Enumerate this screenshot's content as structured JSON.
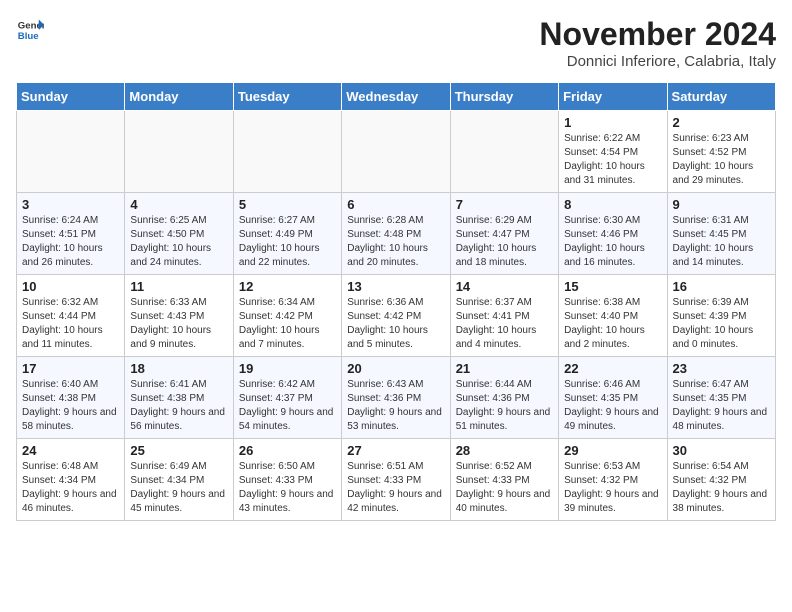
{
  "logo": {
    "line1": "General",
    "line2": "Blue"
  },
  "title": "November 2024",
  "subtitle": "Donnici Inferiore, Calabria, Italy",
  "days_header": [
    "Sunday",
    "Monday",
    "Tuesday",
    "Wednesday",
    "Thursday",
    "Friday",
    "Saturday"
  ],
  "weeks": [
    [
      {
        "day": "",
        "info": ""
      },
      {
        "day": "",
        "info": ""
      },
      {
        "day": "",
        "info": ""
      },
      {
        "day": "",
        "info": ""
      },
      {
        "day": "",
        "info": ""
      },
      {
        "day": "1",
        "info": "Sunrise: 6:22 AM\nSunset: 4:54 PM\nDaylight: 10 hours and 31 minutes."
      },
      {
        "day": "2",
        "info": "Sunrise: 6:23 AM\nSunset: 4:52 PM\nDaylight: 10 hours and 29 minutes."
      }
    ],
    [
      {
        "day": "3",
        "info": "Sunrise: 6:24 AM\nSunset: 4:51 PM\nDaylight: 10 hours and 26 minutes."
      },
      {
        "day": "4",
        "info": "Sunrise: 6:25 AM\nSunset: 4:50 PM\nDaylight: 10 hours and 24 minutes."
      },
      {
        "day": "5",
        "info": "Sunrise: 6:27 AM\nSunset: 4:49 PM\nDaylight: 10 hours and 22 minutes."
      },
      {
        "day": "6",
        "info": "Sunrise: 6:28 AM\nSunset: 4:48 PM\nDaylight: 10 hours and 20 minutes."
      },
      {
        "day": "7",
        "info": "Sunrise: 6:29 AM\nSunset: 4:47 PM\nDaylight: 10 hours and 18 minutes."
      },
      {
        "day": "8",
        "info": "Sunrise: 6:30 AM\nSunset: 4:46 PM\nDaylight: 10 hours and 16 minutes."
      },
      {
        "day": "9",
        "info": "Sunrise: 6:31 AM\nSunset: 4:45 PM\nDaylight: 10 hours and 14 minutes."
      }
    ],
    [
      {
        "day": "10",
        "info": "Sunrise: 6:32 AM\nSunset: 4:44 PM\nDaylight: 10 hours and 11 minutes."
      },
      {
        "day": "11",
        "info": "Sunrise: 6:33 AM\nSunset: 4:43 PM\nDaylight: 10 hours and 9 minutes."
      },
      {
        "day": "12",
        "info": "Sunrise: 6:34 AM\nSunset: 4:42 PM\nDaylight: 10 hours and 7 minutes."
      },
      {
        "day": "13",
        "info": "Sunrise: 6:36 AM\nSunset: 4:42 PM\nDaylight: 10 hours and 5 minutes."
      },
      {
        "day": "14",
        "info": "Sunrise: 6:37 AM\nSunset: 4:41 PM\nDaylight: 10 hours and 4 minutes."
      },
      {
        "day": "15",
        "info": "Sunrise: 6:38 AM\nSunset: 4:40 PM\nDaylight: 10 hours and 2 minutes."
      },
      {
        "day": "16",
        "info": "Sunrise: 6:39 AM\nSunset: 4:39 PM\nDaylight: 10 hours and 0 minutes."
      }
    ],
    [
      {
        "day": "17",
        "info": "Sunrise: 6:40 AM\nSunset: 4:38 PM\nDaylight: 9 hours and 58 minutes."
      },
      {
        "day": "18",
        "info": "Sunrise: 6:41 AM\nSunset: 4:38 PM\nDaylight: 9 hours and 56 minutes."
      },
      {
        "day": "19",
        "info": "Sunrise: 6:42 AM\nSunset: 4:37 PM\nDaylight: 9 hours and 54 minutes."
      },
      {
        "day": "20",
        "info": "Sunrise: 6:43 AM\nSunset: 4:36 PM\nDaylight: 9 hours and 53 minutes."
      },
      {
        "day": "21",
        "info": "Sunrise: 6:44 AM\nSunset: 4:36 PM\nDaylight: 9 hours and 51 minutes."
      },
      {
        "day": "22",
        "info": "Sunrise: 6:46 AM\nSunset: 4:35 PM\nDaylight: 9 hours and 49 minutes."
      },
      {
        "day": "23",
        "info": "Sunrise: 6:47 AM\nSunset: 4:35 PM\nDaylight: 9 hours and 48 minutes."
      }
    ],
    [
      {
        "day": "24",
        "info": "Sunrise: 6:48 AM\nSunset: 4:34 PM\nDaylight: 9 hours and 46 minutes."
      },
      {
        "day": "25",
        "info": "Sunrise: 6:49 AM\nSunset: 4:34 PM\nDaylight: 9 hours and 45 minutes."
      },
      {
        "day": "26",
        "info": "Sunrise: 6:50 AM\nSunset: 4:33 PM\nDaylight: 9 hours and 43 minutes."
      },
      {
        "day": "27",
        "info": "Sunrise: 6:51 AM\nSunset: 4:33 PM\nDaylight: 9 hours and 42 minutes."
      },
      {
        "day": "28",
        "info": "Sunrise: 6:52 AM\nSunset: 4:33 PM\nDaylight: 9 hours and 40 minutes."
      },
      {
        "day": "29",
        "info": "Sunrise: 6:53 AM\nSunset: 4:32 PM\nDaylight: 9 hours and 39 minutes."
      },
      {
        "day": "30",
        "info": "Sunrise: 6:54 AM\nSunset: 4:32 PM\nDaylight: 9 hours and 38 minutes."
      }
    ]
  ]
}
